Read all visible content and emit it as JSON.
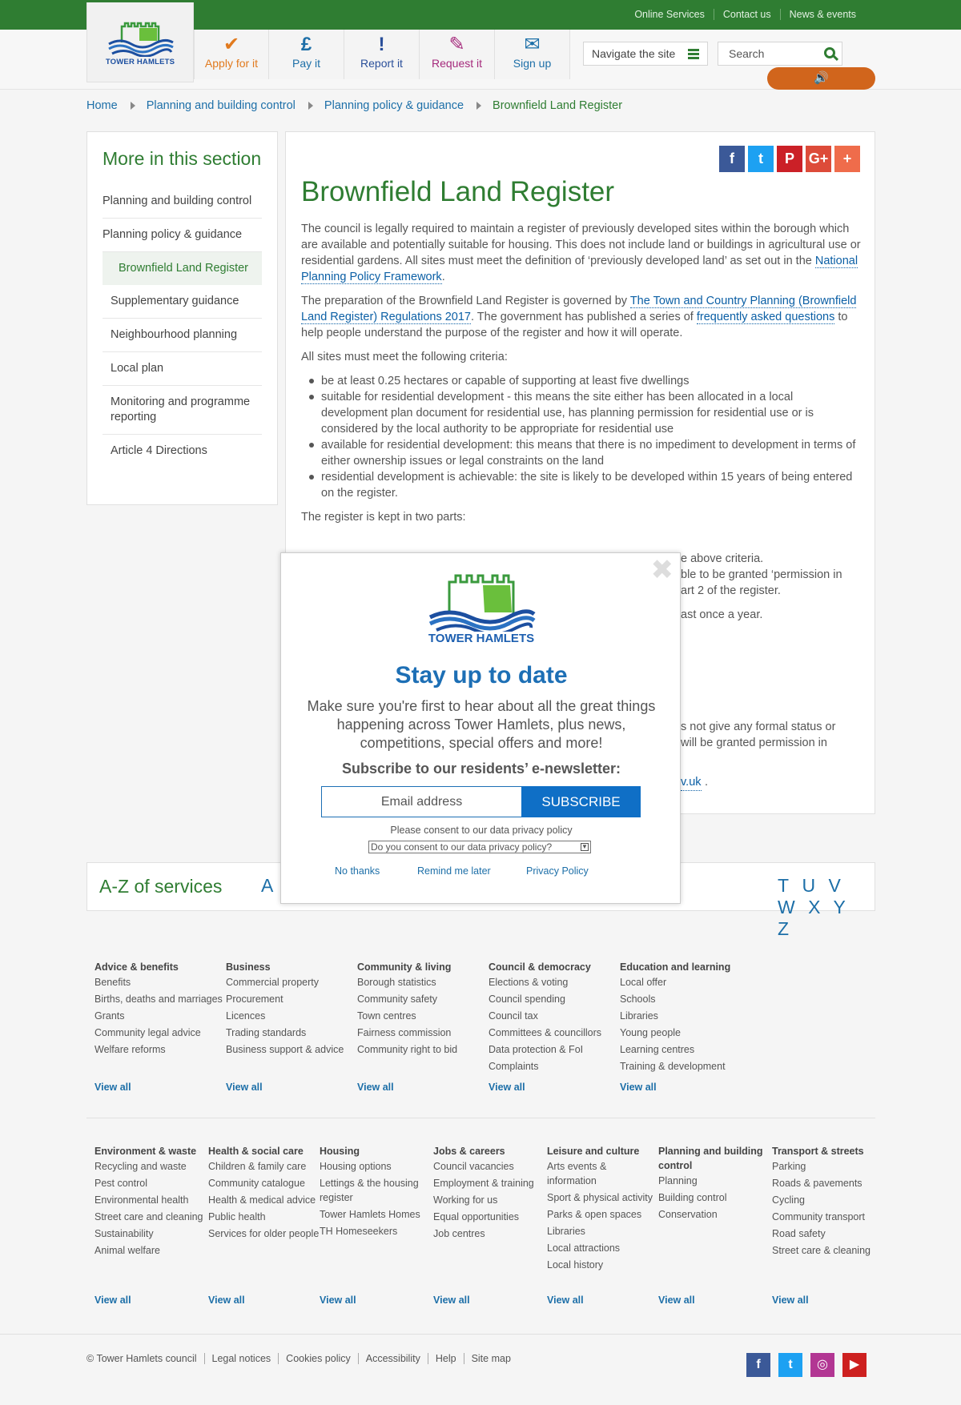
{
  "header": {
    "toplinks": [
      "Online Services",
      "Contact us",
      "News & events"
    ],
    "logo_text": "TOWER HAMLETS",
    "tabs": [
      {
        "label": "Apply for it",
        "icon": "✔"
      },
      {
        "label": "Pay it",
        "icon": "£"
      },
      {
        "label": "Report it",
        "icon": "!"
      },
      {
        "label": "Request it",
        "icon": "✎"
      },
      {
        "label": "Sign up",
        "icon": "✉"
      }
    ],
    "navigate_label": "Navigate the site",
    "search_placeholder": "Search",
    "speaker_icon": "🔊"
  },
  "breadcrumb": [
    "Home",
    "Planning and building control",
    "Planning policy & guidance",
    "Brownfield Land Register"
  ],
  "sidebar": {
    "title": "More in this section",
    "items": [
      "Planning and building control",
      "Planning policy & guidance",
      "Brownfield Land Register",
      "Supplementary guidance",
      "Neighbourhood planning",
      "Local plan",
      "Monitoring and programme reporting",
      "Article 4 Directions"
    ]
  },
  "main": {
    "title": "Brownfield Land Register",
    "share_icons": [
      "f",
      "t",
      "P",
      "G+",
      "+"
    ],
    "p1_text": "The council is legally required to maintain a register of previously developed sites within the borough which are available and potentially suitable for housing. This does not include land or buildings in agricultural use or residential gardens. All sites must meet the definition of ‘previously developed land’ as set out in the ",
    "p1_link": "National Planning Policy Framework",
    "p2_text_a": "The preparation of the Brownfield Land Register is governed by ",
    "p2_link_a": "The Town and Country Planning (Brownfield Land Register) Regulations 2017",
    "p2_text_b": ". The government has published a series of ",
    "p2_link_b": "frequently asked questions",
    "p2_text_c": " to help people understand the purpose of the register and how it will operate.",
    "p3": "All sites must meet the following criteria:",
    "criteria": [
      "be at least 0.25 hectares or capable of  supporting at least five dwellings",
      "suitable for residential development - this means the site either has been allocated in a local development plan document for residential use, has planning permission for residential use or is considered by the local authority to be appropriate for residential use",
      "available for residential development: this  means that there is no impediment to development in terms of either ownership issues or legal constraints on the land",
      "residential development is achievable: the site is likely to be developed within 15 years of being entered on the register."
    ],
    "p4": "The register is kept in two parts:",
    "frag1": "e above criteria.",
    "frag2": "ble to be granted ‘permission in",
    "frag3": "art 2 of the register.",
    "frag4": "ast once a year.",
    "frag5": "s not give any formal status or",
    "frag6": "will be granted permission in",
    "frag7": "v.uk"
  },
  "az": {
    "title": "A-Z of services",
    "letters_left": [
      "A"
    ],
    "letters_right": [
      "T",
      "U",
      "V",
      "W",
      "X",
      "Y",
      "Z"
    ]
  },
  "services_row1": [
    {
      "heading": "Advice & benefits",
      "items": [
        "Benefits",
        "Births, deaths and marriages",
        "Grants",
        "Community legal advice",
        "Welfare reforms"
      ]
    },
    {
      "heading": "Business",
      "items": [
        "Commercial property",
        "Procurement",
        "Licences",
        "Trading standards",
        "Business support & advice"
      ]
    },
    {
      "heading": "Community & living",
      "items": [
        "Borough statistics",
        "Community safety",
        "Town centres",
        "Fairness commission",
        "Community right to bid"
      ]
    },
    {
      "heading": "Council & democracy",
      "items": [
        "Elections & voting",
        "Council spending",
        "Council tax",
        "Committees & councillors",
        "Data protection & FoI",
        "Complaints"
      ]
    },
    {
      "heading": "Education and learning",
      "items": [
        "Local offer",
        "Schools",
        "Libraries",
        "Young people",
        "Learning centres",
        "Training & development"
      ]
    }
  ],
  "services_row2": [
    {
      "heading": "Environment & waste",
      "items": [
        "Recycling and waste",
        "Pest control",
        "Environmental health",
        "Street care and cleaning",
        "Sustainability",
        "Animal welfare"
      ]
    },
    {
      "heading": "Health & social care",
      "items": [
        "Children & family care",
        "Community catalogue",
        "Health & medical advice",
        "Public health",
        "Services for older people"
      ]
    },
    {
      "heading": "Housing",
      "items": [
        "Housing options",
        "Lettings & the housing register",
        "Tower Hamlets Homes",
        "TH Homeseekers"
      ]
    },
    {
      "heading": "Jobs & careers",
      "items": [
        "Council vacancies",
        "Employment & training",
        "Working for us",
        "Equal opportunities",
        "Job centres"
      ]
    },
    {
      "heading": "Leisure and culture",
      "items": [
        "Arts events & information",
        "Sport & physical activity",
        "Parks & open spaces",
        "Libraries",
        "Local attractions",
        "Local history"
      ]
    },
    {
      "heading": "Planning and building control",
      "items": [
        "Planning",
        "Building control",
        "Conservation"
      ]
    },
    {
      "heading": "Transport & streets",
      "items": [
        "Parking",
        "Roads & pavements",
        "Cycling",
        "Community transport",
        "Road safety",
        "Street care & cleaning"
      ]
    }
  ],
  "view_all": "View all",
  "footer": {
    "links": [
      "© Tower Hamlets council",
      "Legal notices",
      "Cookies policy",
      "Accessibility",
      "Help",
      "Site map"
    ],
    "social": [
      "f",
      "t",
      "◎",
      "▶"
    ]
  },
  "modal": {
    "logo_text": "TOWER HAMLETS",
    "title": "Stay up to date",
    "description": "Make sure you're first to hear about all the great things happening across Tower Hamlets, plus news, competitions, special offers and more!",
    "subheading": "Subscribe to our residents’ e-newsletter:",
    "email_placeholder": "Email address",
    "subscribe_label": "SUBSCRIBE",
    "consent_text": "Please consent to our data privacy policy",
    "consent_select": "Do you consent to our data privacy policy?",
    "links": [
      "No thanks",
      "Remind me later",
      "Privacy Policy"
    ],
    "close": "✖"
  },
  "colors": {
    "brand_green": "#2f7d32",
    "link_blue": "#1d6fa8",
    "subscribe_blue": "#0f6fc6",
    "speaker_orange": "#d1651c"
  }
}
